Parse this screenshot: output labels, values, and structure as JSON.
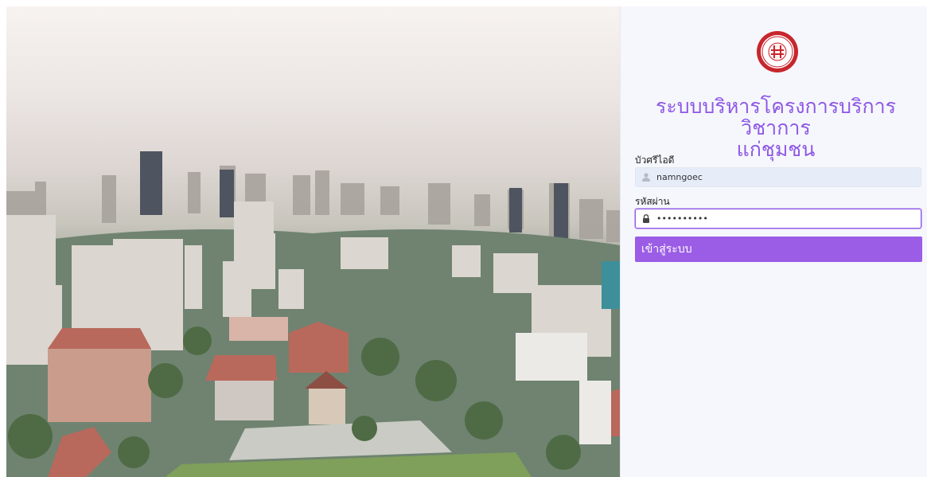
{
  "app": {
    "title": "ระบบบริหารโครงการบริการวิชาการแก่ชุมชน",
    "title_line1": "ระบบบริหารโครงการบริการวิชาการ",
    "title_line2": "แก่ชุมชน"
  },
  "login": {
    "username_label": "บัวศรีไอดี",
    "username_value": "namngoec",
    "password_label": "รหัสผ่าน",
    "password_value": "••••••••••",
    "submit_label": "เข้าสู่ระบบ"
  },
  "icons": {
    "logo": "university-seal-icon",
    "username": "user-icon",
    "password": "lock-icon"
  },
  "colors": {
    "accent": "#9b5de5",
    "title": "#8f58e6",
    "panel_bg": "#f5f7fc",
    "seal_red": "#c8262d"
  }
}
